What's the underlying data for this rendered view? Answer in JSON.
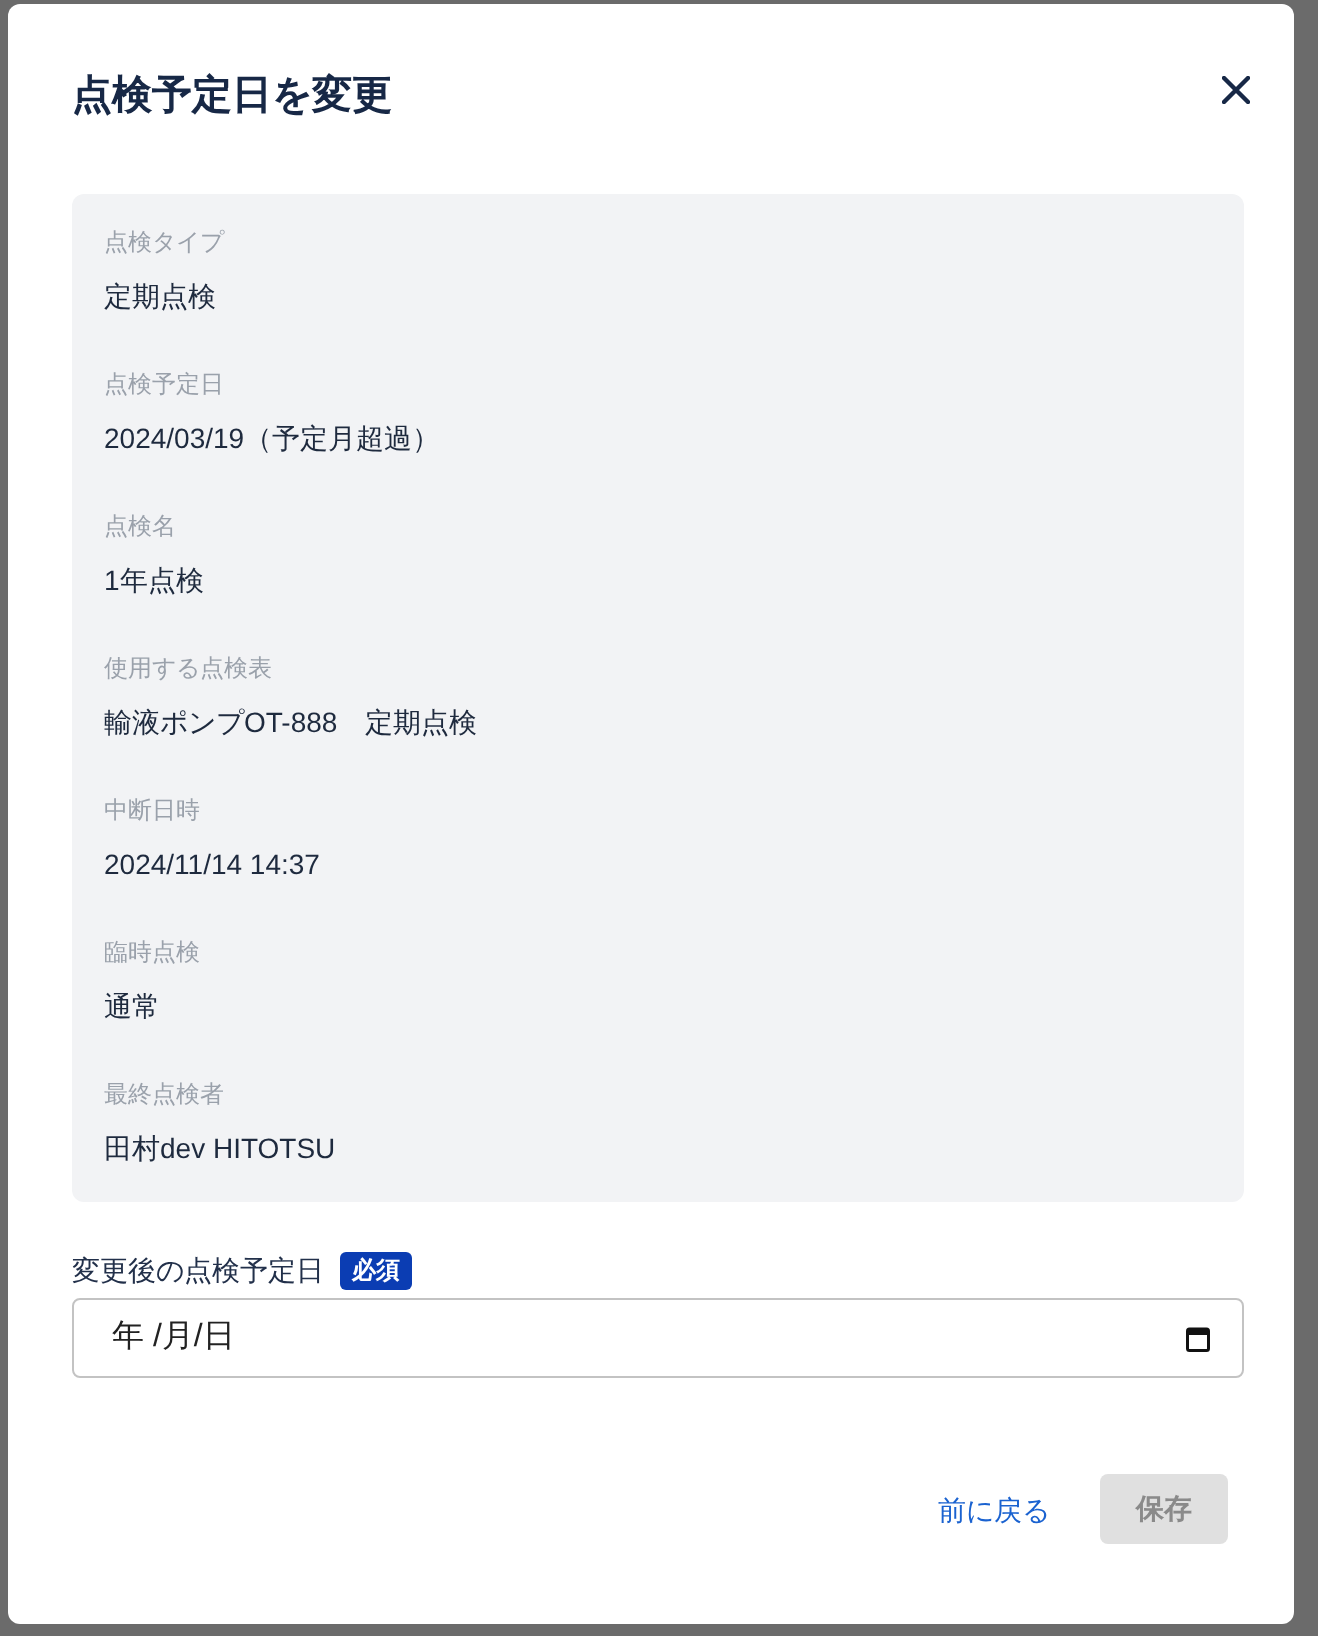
{
  "dialog": {
    "title": "点検予定日を変更"
  },
  "details": [
    {
      "label": "点検タイプ",
      "value": "定期点検"
    },
    {
      "label": "点検予定日",
      "value": "2024/03/19（予定月超過）"
    },
    {
      "label": "点検名",
      "value": "1年点検"
    },
    {
      "label": "使用する点検表",
      "value": "輸液ポンプOT-888　定期点検"
    },
    {
      "label": "中断日時",
      "value": "2024/11/14 14:37"
    },
    {
      "label": "臨時点検",
      "value": "通常"
    },
    {
      "label": "最終点検者",
      "value": "田村dev HITOTSU"
    }
  ],
  "date_field": {
    "label": "変更後の点検予定日",
    "badge": "必須",
    "placeholder": "年 /月/日"
  },
  "actions": {
    "back": {
      "label": "前に戻る"
    },
    "save": {
      "label": "保存",
      "disabled": true
    }
  }
}
